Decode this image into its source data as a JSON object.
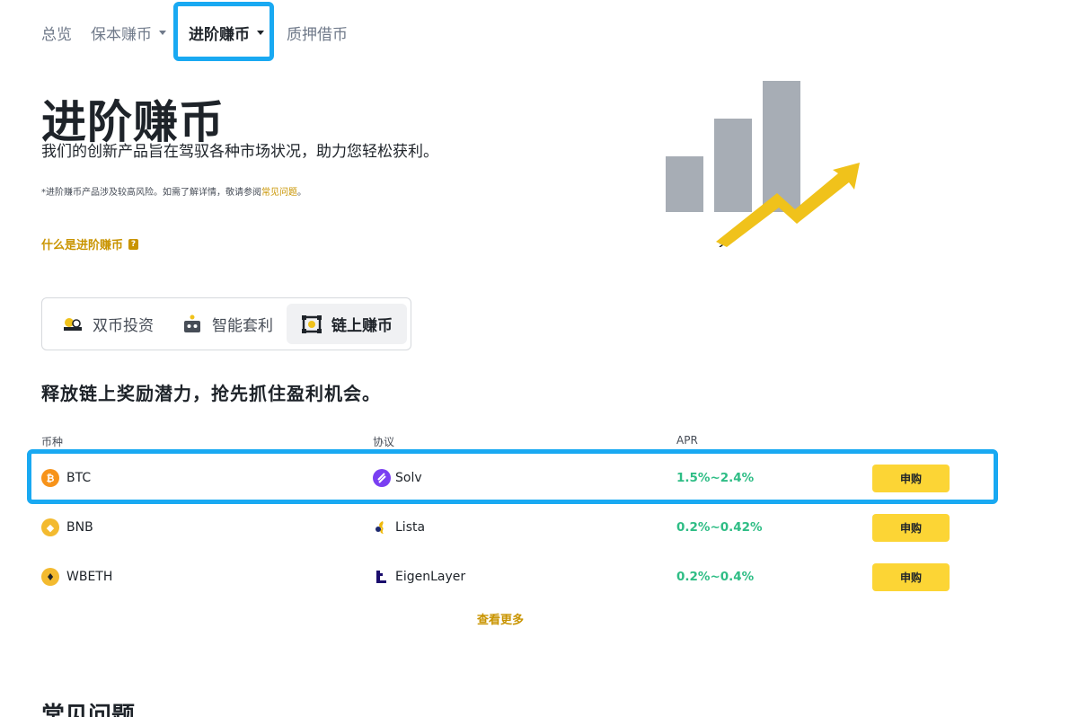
{
  "nav": {
    "items": [
      {
        "label": "总览"
      },
      {
        "label": "保本赚币"
      },
      {
        "label": "进阶赚币"
      },
      {
        "label": "质押借币"
      }
    ]
  },
  "hero": {
    "title": "进阶赚币",
    "subtitle": "我们的创新产品旨在驾驭各种市场状况，助力您轻松获利。",
    "note_prefix": "*进阶赚币产品涉及较高风险。如需了解详情，敬请参阅",
    "note_link": "常见问题",
    "note_suffix": "。",
    "what_link": "什么是进阶赚币"
  },
  "tabs": [
    {
      "label": "双币投资",
      "icon": "dual-currency-icon"
    },
    {
      "label": "智能套利",
      "icon": "robot-icon"
    },
    {
      "label": "链上赚币",
      "icon": "onchain-icon"
    }
  ],
  "section_title": "释放链上奖励潜力，抢先抓住盈利机会。",
  "table": {
    "headers": {
      "coin": "币种",
      "protocol": "协议",
      "apr": "APR"
    },
    "rows": [
      {
        "coin": "BTC",
        "coin_color": "#f7931a",
        "coin_glyph": "₿",
        "protocol": "Solv",
        "apr": "1.5%~2.4%",
        "action": "申购"
      },
      {
        "coin": "BNB",
        "coin_color": "#f3ba2f",
        "coin_glyph": "◆",
        "protocol": "Lista",
        "apr": "0.2%~0.42%",
        "action": "申购"
      },
      {
        "coin": "WBETH",
        "coin_color": "#f3ba2f",
        "coin_glyph": "♦",
        "protocol": "EigenLayer",
        "apr": "0.2%~0.4%",
        "action": "申购"
      }
    ],
    "more": "查看更多"
  },
  "faq_title": "常见问题"
}
